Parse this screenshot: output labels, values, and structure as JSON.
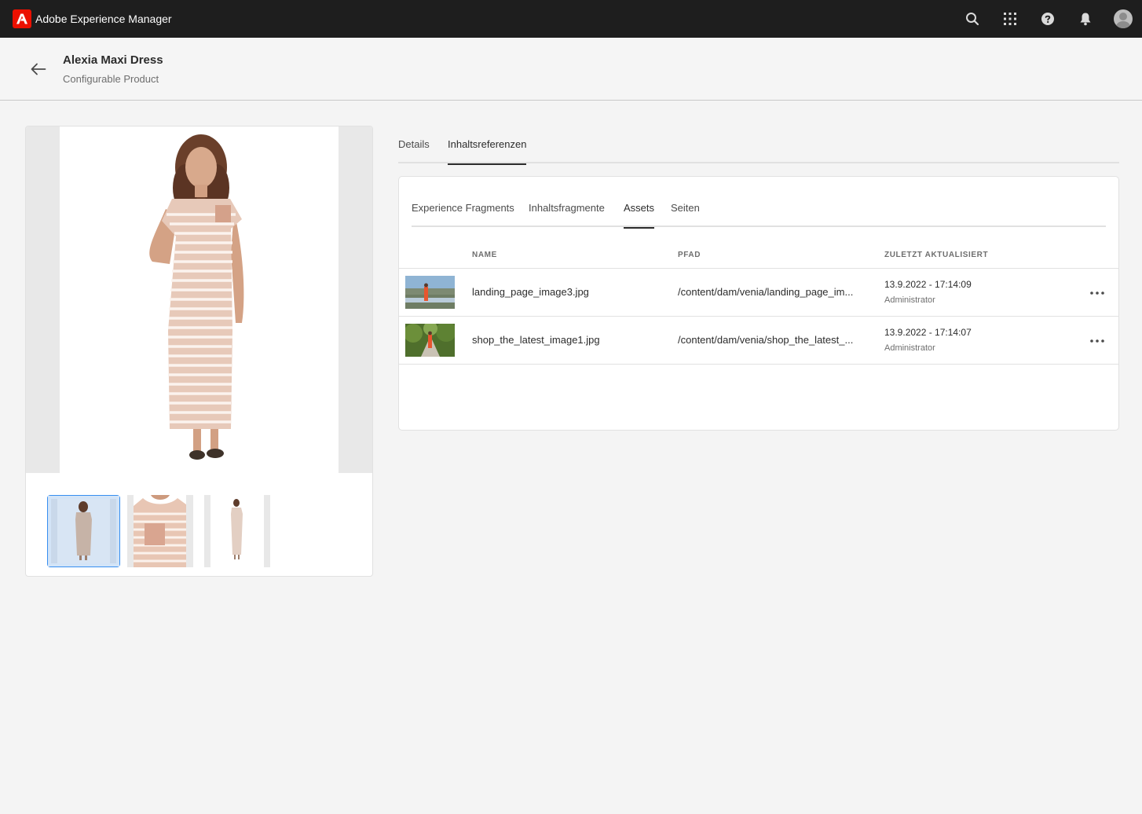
{
  "shell": {
    "brand_name": "Adobe Experience Manager",
    "icons": [
      "search-icon",
      "apps-grid-icon",
      "help-icon",
      "notifications-bell-icon",
      "user-avatar"
    ]
  },
  "header": {
    "title": "Alexia Maxi Dress",
    "subtitle": "Configurable Product"
  },
  "product_images": {
    "thumbnail_count": 3,
    "selected_thumbnail": 1
  },
  "tabs": [
    {
      "label": "Details",
      "active": false
    },
    {
      "label": "Inhaltsreferenzen",
      "active": true
    }
  ],
  "references": {
    "subtabs": [
      {
        "label": "Experience Fragments",
        "active": false
      },
      {
        "label": "Inhaltsfragmente",
        "active": false
      },
      {
        "label": "Assets",
        "active": true
      },
      {
        "label": "Seiten",
        "active": false
      }
    ],
    "columns": {
      "name": "NAME",
      "path": "PFAD",
      "updated": "ZULETZT AKTUALISIERT"
    },
    "rows": [
      {
        "name": "landing_page_image3.jpg",
        "path": "/content/dam/venia/landing_page_im...",
        "updated": "13.9.2022 - 17:14:09",
        "user": "Administrator"
      },
      {
        "name": "shop_the_latest_image1.jpg",
        "path": "/content/dam/venia/shop_the_latest_...",
        "updated": "13.9.2022 - 17:14:07",
        "user": "Administrator"
      }
    ]
  },
  "colors": {
    "shell_bg": "#1e1e1e",
    "brand_red": "#eb1000",
    "page_bg": "#f4f4f4",
    "selection_blue": "#378ef0"
  }
}
